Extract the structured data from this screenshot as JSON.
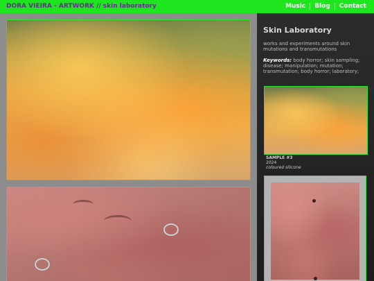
{
  "header": {
    "title": "DORA VIEIRA - ARTWORK // skin laboratory",
    "nav": [
      "Music",
      "Blog",
      "Contact"
    ]
  },
  "sidebar": {
    "title": "Skin Laboratory",
    "description": "works and experiments around skin mutations and transmutations",
    "keywords_label": "Keywords:",
    "keywords": " body horror; skin sampling; disease; manipulation; mutation; transmutation; body horror; laboratory;",
    "sample": {
      "title": "SAMPLE #3",
      "year": "2024",
      "material": "coloured silicone"
    }
  },
  "colors": {
    "accent": "#1ee61e",
    "title_text": "#6a2a94",
    "sidebar_bg": "#262626",
    "page_bg": "#8c8c8c"
  }
}
